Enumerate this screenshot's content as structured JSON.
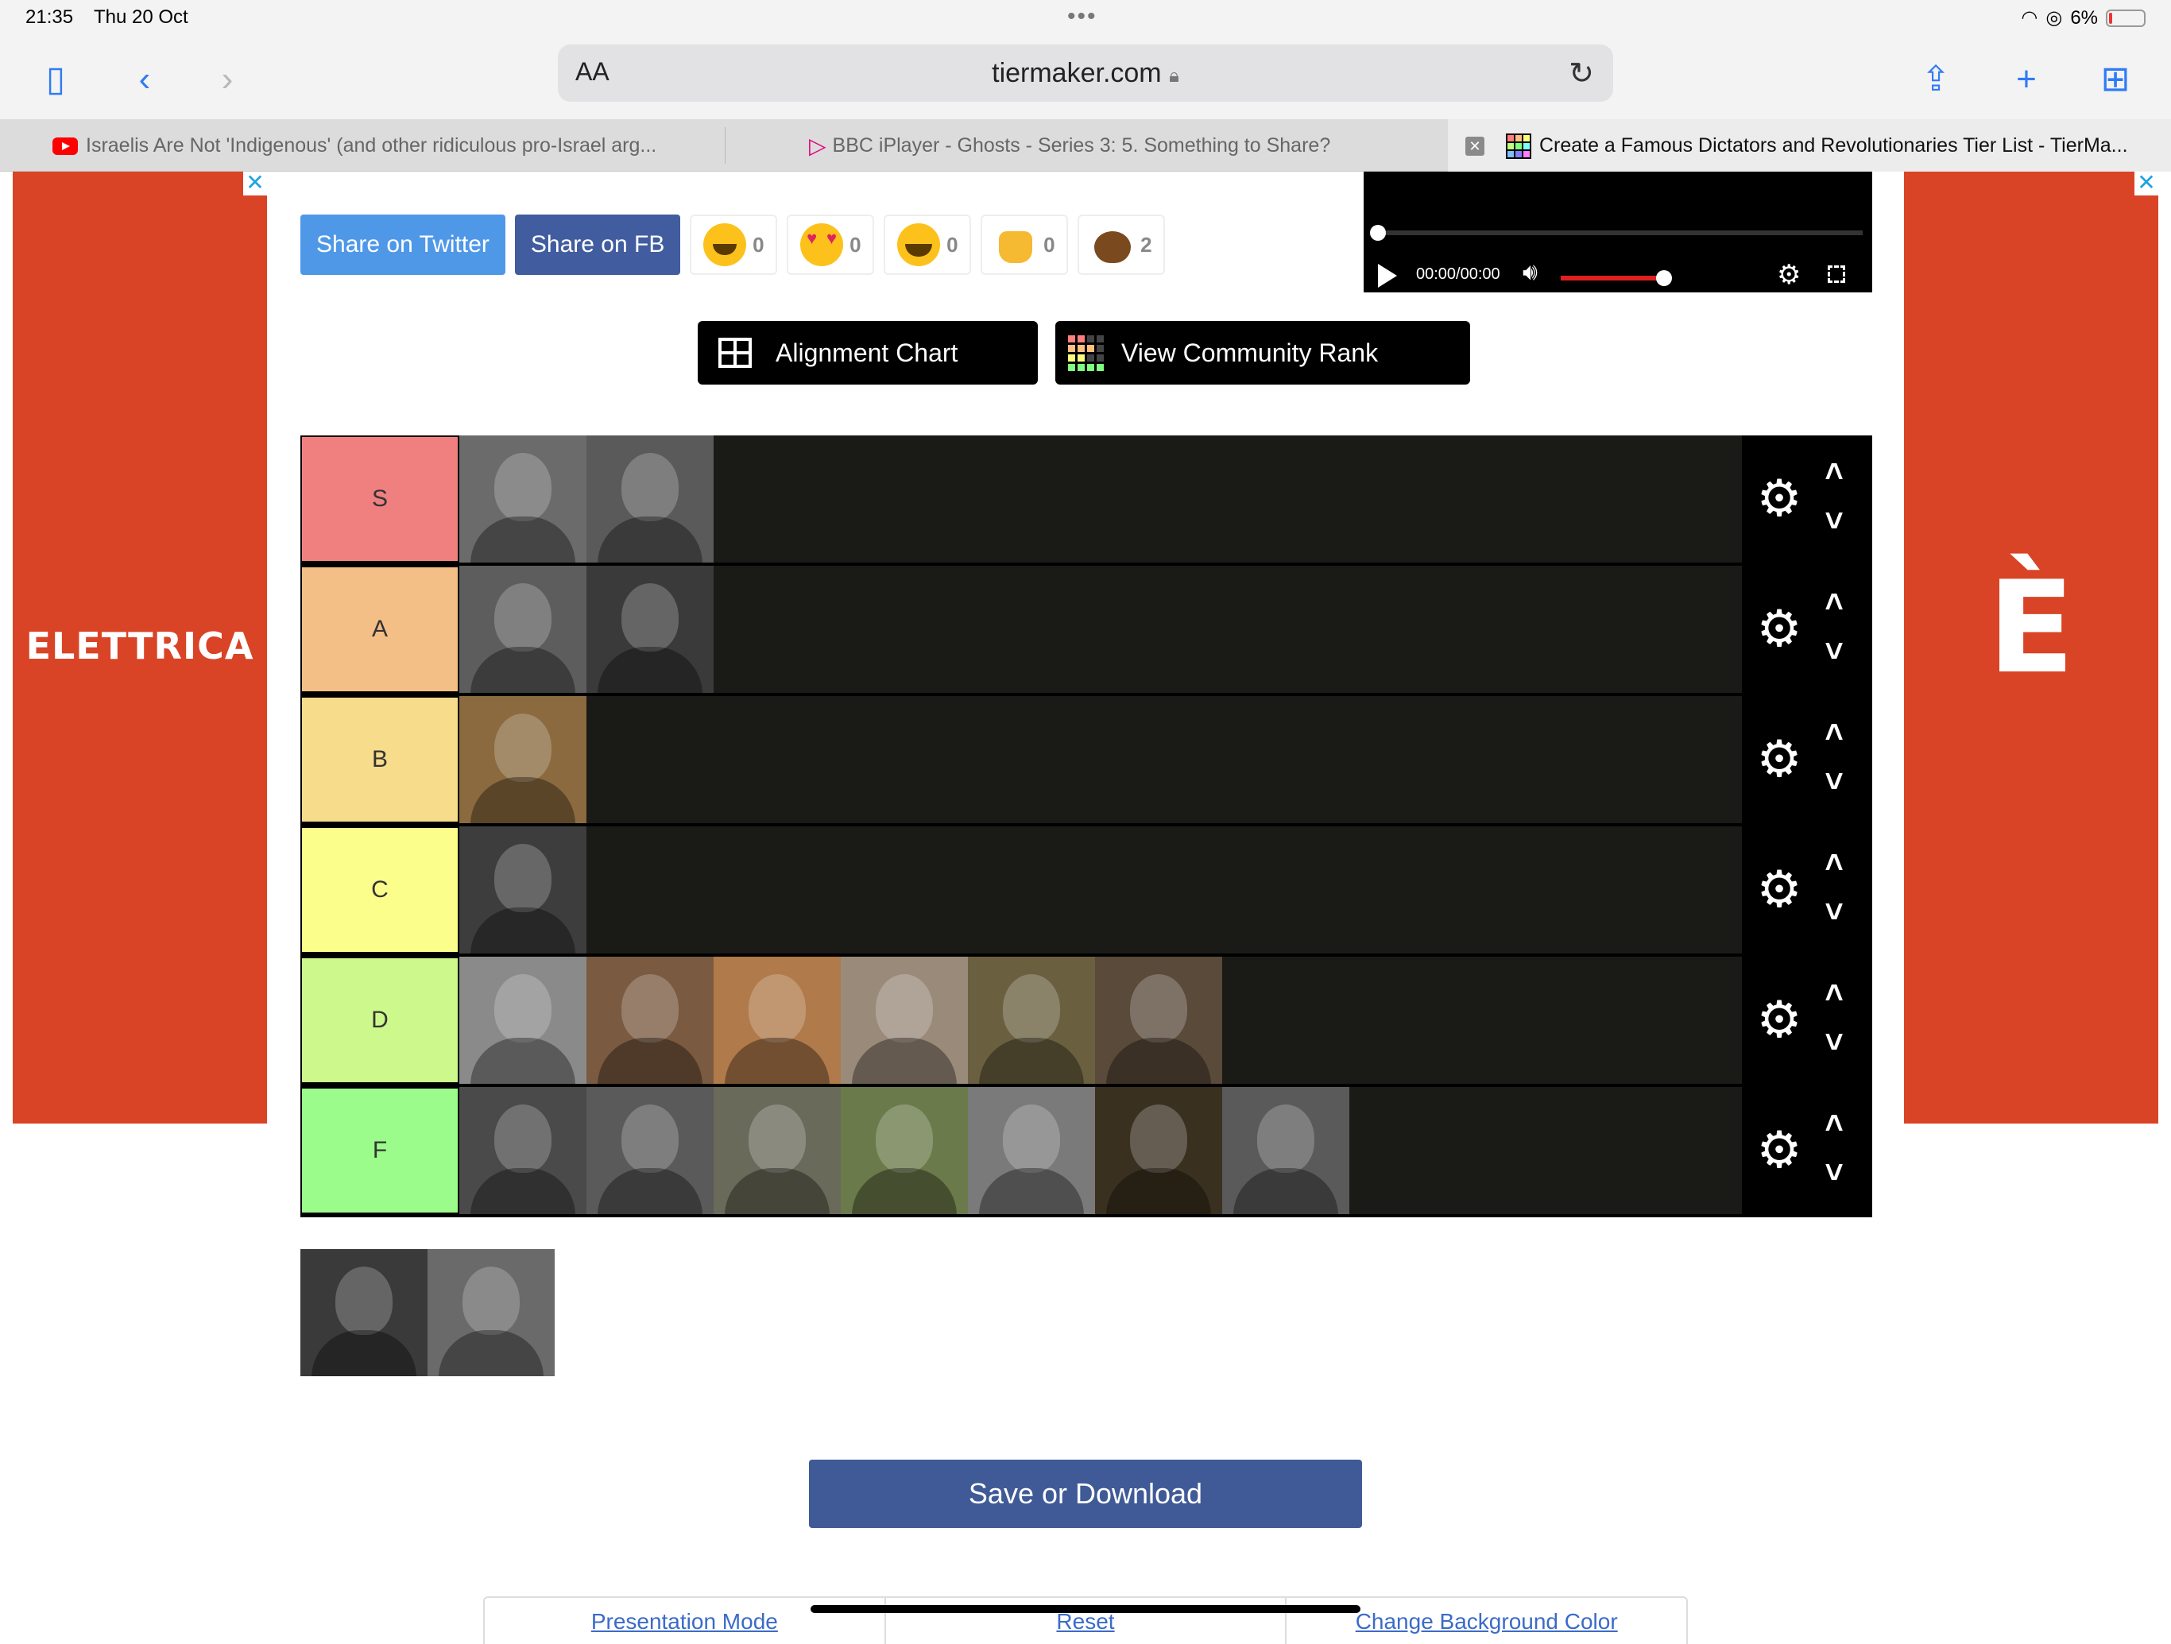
{
  "status_bar": {
    "time": "21:35",
    "date": "Thu 20 Oct",
    "battery": "6%"
  },
  "toolbar": {
    "aa_label": "AA",
    "url": "tiermaker.com",
    "lock_icon": "lock-icon"
  },
  "tabs": [
    {
      "title": "Israelis Are Not 'Indigenous' (and other ridiculous pro-Israel arg...",
      "icon": "youtube-icon"
    },
    {
      "title": "BBC iPlayer - Ghosts - Series 3: 5. Something to Share?",
      "icon": "iplayer-icon"
    },
    {
      "title": "Create a Famous Dictators and Revolutionaries Tier List - TierMa...",
      "icon": "tiermaker-icon",
      "active": true
    }
  ],
  "ads": {
    "left_text": "ELETTRICA",
    "right_text": "È",
    "close_glyph": "✕",
    "color": "#d94426"
  },
  "share": {
    "twitter": "Share on Twitter",
    "fb": "Share on FB"
  },
  "reactions": [
    {
      "icon": "grinning-face-icon",
      "count": "0"
    },
    {
      "icon": "heart-eyes-face-icon",
      "count": "0"
    },
    {
      "icon": "tears-of-joy-face-icon",
      "count": "0"
    },
    {
      "icon": "raising-hands-icon",
      "count": "0"
    },
    {
      "icon": "pile-of-poo-icon",
      "count": "2"
    }
  ],
  "video": {
    "time": "00:00/00:00"
  },
  "buttons": {
    "alignment_chart": "Alignment Chart",
    "community_rank": "View Community Rank",
    "save": "Save or Download"
  },
  "tiers": [
    {
      "label": "S",
      "color": "#f08080",
      "items": [
        {
          "tone": "#6b6b6b"
        },
        {
          "tone": "#5a5a5a"
        }
      ]
    },
    {
      "label": "A",
      "color": "#f4bf86",
      "items": [
        {
          "tone": "#5d5d5d"
        },
        {
          "tone": "#3a3a3a"
        }
      ]
    },
    {
      "label": "B",
      "color": "#f7dc8b",
      "items": [
        {
          "tone": "#8a6a3e"
        }
      ]
    },
    {
      "label": "C",
      "color": "#fcfe8c",
      "items": [
        {
          "tone": "#3d3d3d"
        }
      ]
    },
    {
      "label": "D",
      "color": "#cdf88b",
      "items": [
        {
          "tone": "#8a8a8a"
        },
        {
          "tone": "#7a5a40"
        },
        {
          "tone": "#b07a4a"
        },
        {
          "tone": "#9a8a7a"
        },
        {
          "tone": "#6a6040"
        },
        {
          "tone": "#5a4a3a"
        }
      ]
    },
    {
      "label": "F",
      "color": "#9cfc8b",
      "items": [
        {
          "tone": "#4a4a4a"
        },
        {
          "tone": "#5a5a5a"
        },
        {
          "tone": "#6a6a5a"
        },
        {
          "tone": "#6a7a4a"
        },
        {
          "tone": "#7a7a7a"
        },
        {
          "tone": "#3a3020"
        },
        {
          "tone": "#5a5a5a"
        }
      ]
    }
  ],
  "unranked": [
    {
      "tone": "#3a3a3a"
    },
    {
      "tone": "#6a6a6a"
    }
  ],
  "bottom_tabs": [
    "Presentation Mode",
    "Reset",
    "Change Background Color"
  ]
}
